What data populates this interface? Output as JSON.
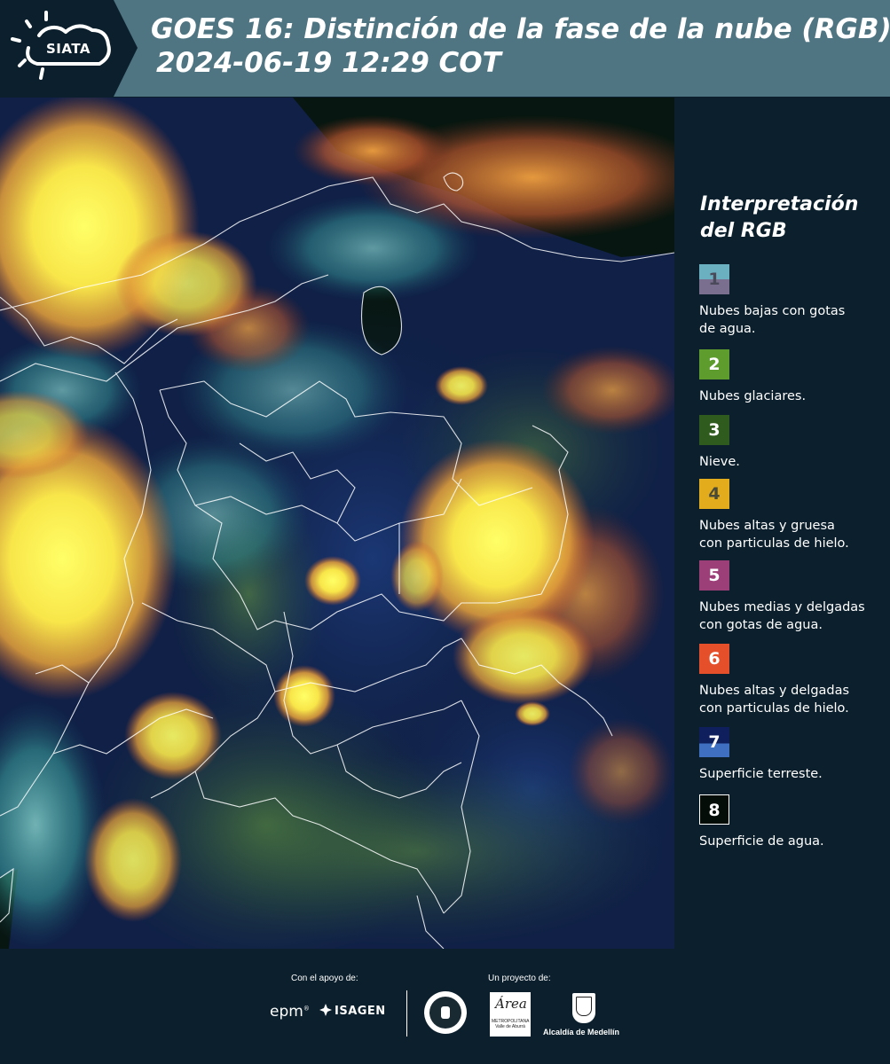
{
  "header": {
    "logo_text": "SIATA",
    "title_line1": "GOES 16: Distinción de la fase de la nube (RGB)",
    "title_line2": "2024-06-19 12:29 COT",
    "background_color": "#4f7482",
    "logo_background_color": "#0c1f2c"
  },
  "legend": {
    "title_line1": "Interpretación",
    "title_line2": "del RGB",
    "items": [
      {
        "number": "1",
        "label_line1": "Nubes bajas con gotas",
        "label_line2": "de agua.",
        "color_top": "#6ab0c0",
        "color_bottom": "#7a6f8e",
        "number_color": "#4a4a5a"
      },
      {
        "number": "2",
        "label_line1": "Nubes glaciares.",
        "label_line2": "",
        "color_top": "#5e9c2e",
        "color_bottom": "#5e9c2e",
        "number_color": "#ffffff"
      },
      {
        "number": "3",
        "label_line1": "Nieve.",
        "label_line2": "",
        "color_top": "#2f5b1e",
        "color_bottom": "#2f5b1e",
        "number_color": "#ffffff"
      },
      {
        "number": "4",
        "label_line1": "Nubes altas y gruesa",
        "label_line2": "con particulas de hielo.",
        "color_top": "#e3ac1c",
        "color_bottom": "#e3ac1c",
        "number_color": "#4a4a3a"
      },
      {
        "number": "5",
        "label_line1": "Nubes medias y delgadas",
        "label_line2": "con gotas de agua.",
        "color_top": "#9c3f78",
        "color_bottom": "#9c3f78",
        "number_color": "#ffffff"
      },
      {
        "number": "6",
        "label_line1": "Nubes altas y delgadas",
        "label_line2": "con particulas de hielo.",
        "color_top": "#e5502b",
        "color_bottom": "#e5502b",
        "number_color": "#ffffff"
      },
      {
        "number": "7",
        "label_line1": "Superficie terreste.",
        "label_line2": "",
        "color_top": "#0f1f5e",
        "color_bottom": "#3f6fc0",
        "number_color": "#ffffff"
      },
      {
        "number": "8",
        "label_line1": "Superficie de agua.",
        "label_line2": "",
        "color_top": "#050d08",
        "color_bottom": "#050d08",
        "number_color": "#ffffff"
      }
    ]
  },
  "footer": {
    "support_label": "Con el apoyo de:",
    "project_label": "Un proyecto de:",
    "epm": "epm",
    "isagen": "ISAGEN",
    "area_script": "Área",
    "area_text": "METROPOLITANA Valle de Aburrá",
    "alcaldia": "Alcaldía de Medellín"
  }
}
